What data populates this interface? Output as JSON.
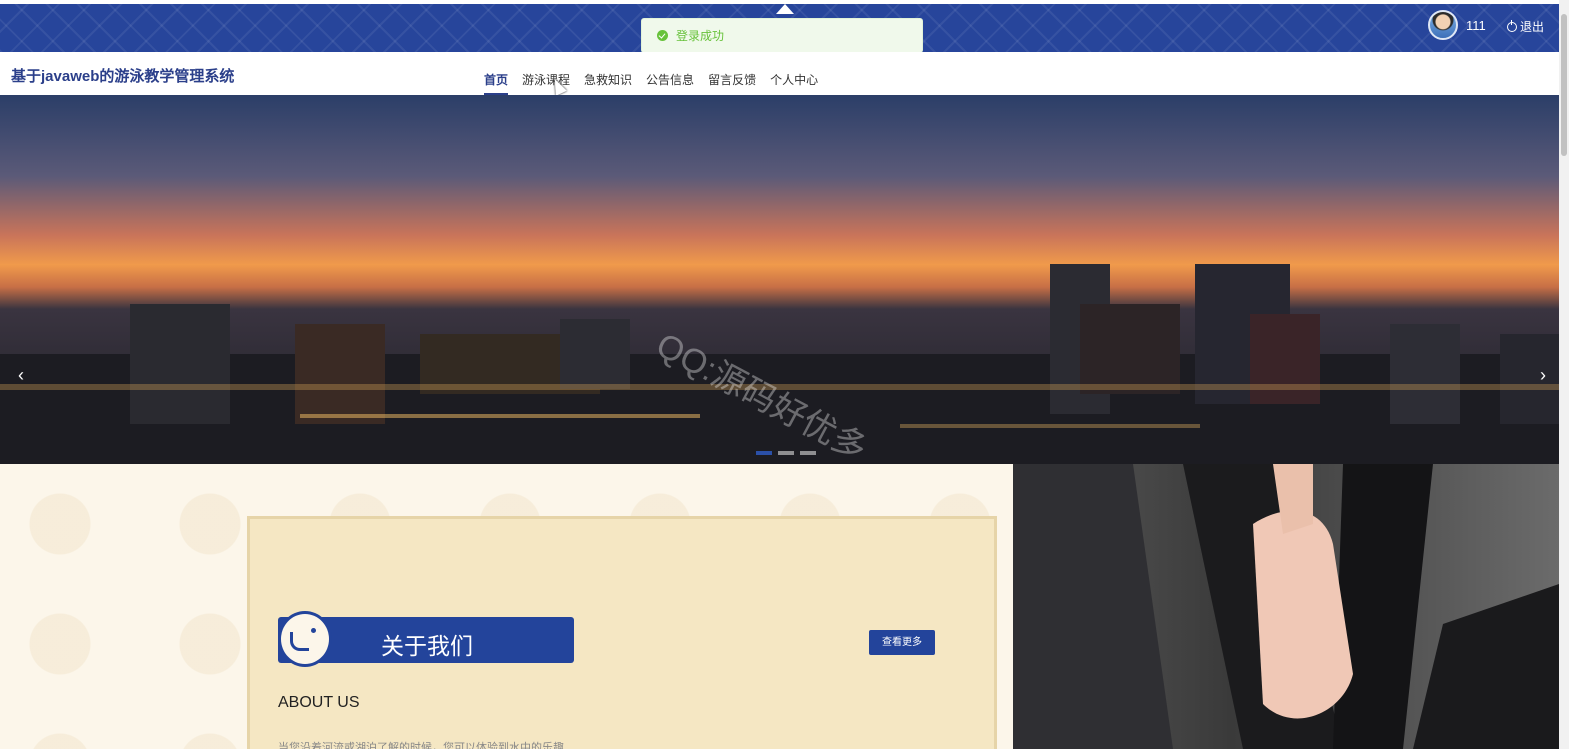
{
  "topbar": {
    "user_name": "111",
    "logout_label": "退出",
    "brand_color": "#27459b"
  },
  "toast": {
    "message": "登录成功",
    "color": "#67c23a"
  },
  "header": {
    "title": "基于javaweb的游泳教学管理系统"
  },
  "nav": {
    "items": [
      "首页",
      "游泳课程",
      "急救知识",
      "公告信息",
      "留言反馈",
      "个人中心"
    ],
    "active_index": 0
  },
  "banner": {
    "prev_label": "‹",
    "next_label": "›",
    "watermark": "QQ:源码好优多",
    "slide_count": 3,
    "active_slide": 0
  },
  "about": {
    "title": "关于我们",
    "subtitle": "ABOUT US",
    "more_label": "查看更多",
    "text": "当您沿着河流或湖泊了解的时候，您可以体验到水中的乐趣……"
  }
}
